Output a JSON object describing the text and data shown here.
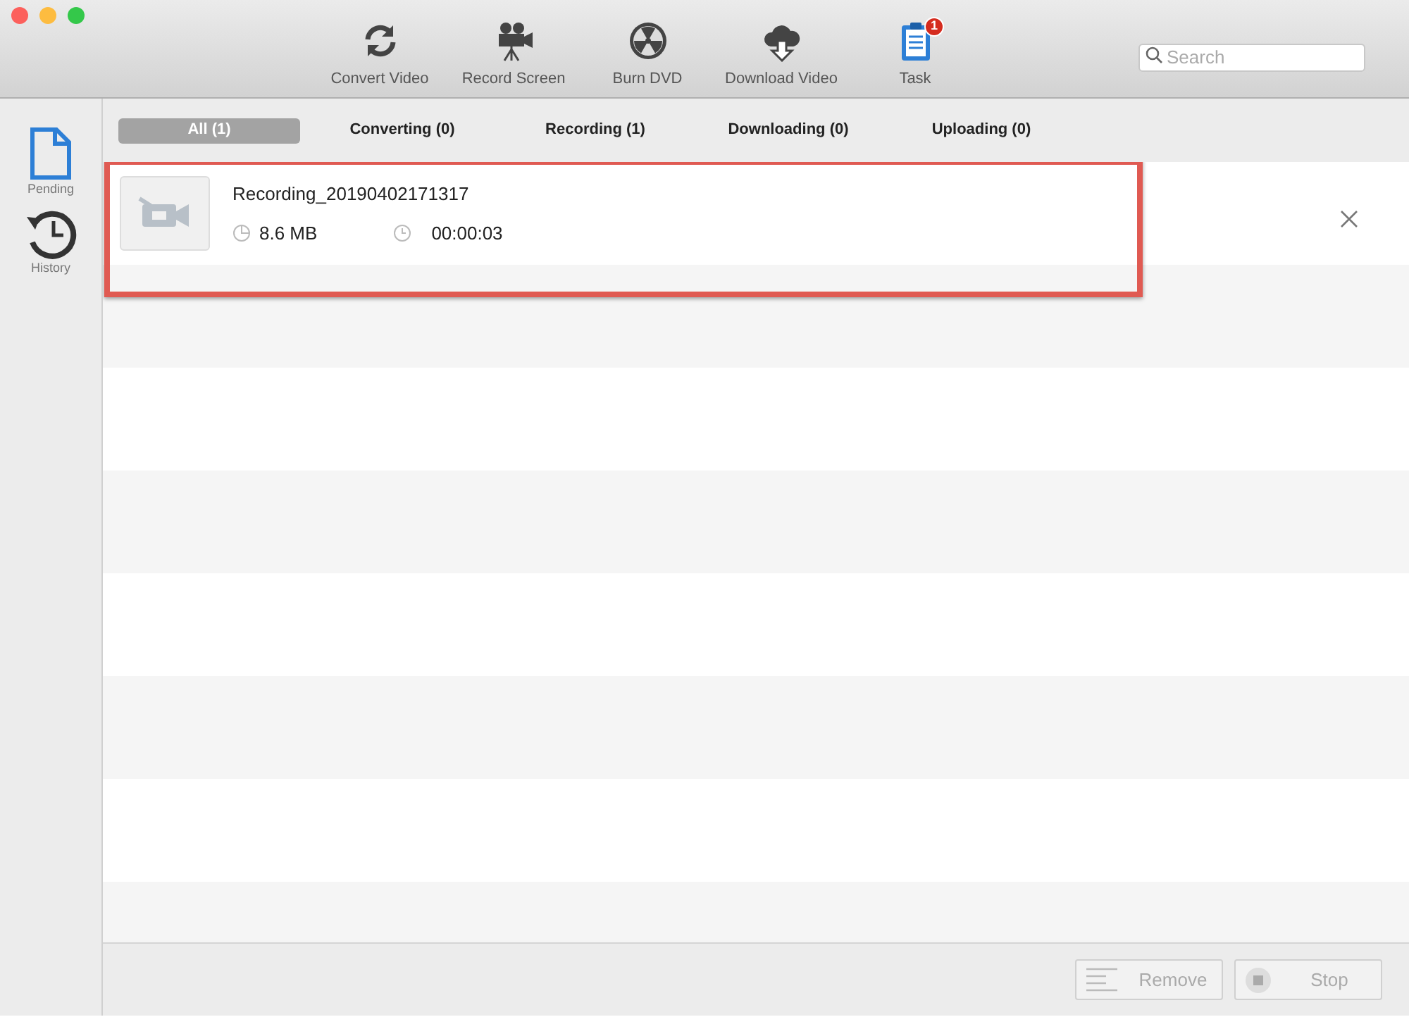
{
  "toolbar": [
    {
      "kind": "convert",
      "label": "Convert Video"
    },
    {
      "kind": "record",
      "label": "Record Screen"
    },
    {
      "kind": "burn",
      "label": "Burn DVD"
    },
    {
      "kind": "download",
      "label": "Download Video"
    },
    {
      "kind": "task",
      "label": "Task",
      "badge": "1"
    }
  ],
  "search": {
    "placeholder": "Search"
  },
  "sidebar": [
    {
      "kind": "pending",
      "label": "Pending",
      "selected": true
    },
    {
      "kind": "history",
      "label": "History",
      "selected": false
    }
  ],
  "tabs": [
    {
      "label": "All (1)",
      "selected": true
    },
    {
      "label": "Converting (0)",
      "selected": false
    },
    {
      "label": "Recording (1)",
      "selected": false
    },
    {
      "label": "Downloading (0)",
      "selected": false
    },
    {
      "label": "Uploading (0)",
      "selected": false
    }
  ],
  "tasks": [
    {
      "name": "Recording_20190402171317",
      "size": "8.6 MB",
      "duration": "00:00:03",
      "highlighted": true
    }
  ],
  "buttons": [
    {
      "kind": "remove",
      "label": "Remove",
      "disabled": true
    },
    {
      "kind": "stop",
      "label": "Stop",
      "disabled": true
    }
  ]
}
